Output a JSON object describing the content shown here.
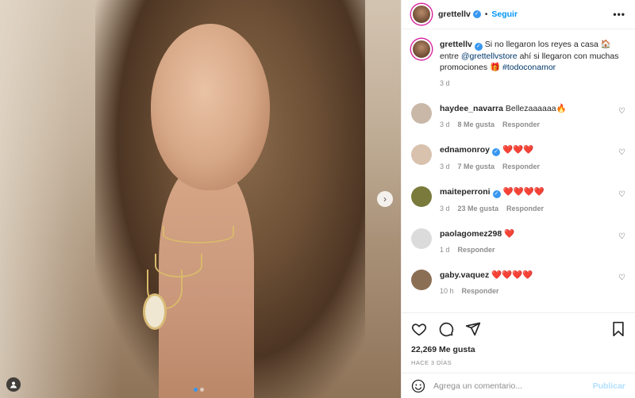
{
  "post": {
    "username": "grettellv",
    "follow_label": "Seguir",
    "more_label": "•••",
    "caption": {
      "username": "grettellv",
      "text_1": "Si no llegaron los reyes a casa 🏠 entre",
      "mention": "@grettellvstore",
      "text_2": "ahí si llegaron con muchas promociones 🎁",
      "hashtag": "#todoconamor",
      "time": "3 d"
    }
  },
  "comments": [
    {
      "username": "haydee_navarra",
      "verified": false,
      "text": "Bellezaaaaaa🔥",
      "time": "3 d",
      "likes": "8 Me gusta",
      "reply": "Responder",
      "avatar_color": "#c9b8a8"
    },
    {
      "username": "ednamonroy",
      "verified": true,
      "text": "❤️❤️❤️",
      "time": "3 d",
      "likes": "7 Me gusta",
      "reply": "Responder",
      "avatar_color": "#d8c2ad"
    },
    {
      "username": "maiteperroni",
      "verified": true,
      "text": "❤️❤️❤️❤️",
      "time": "3 d",
      "likes": "23 Me gusta",
      "reply": "Responder",
      "avatar_color": "#7a7a3c"
    },
    {
      "username": "paolagomez298",
      "verified": false,
      "text": "❤️",
      "time": "1 d",
      "likes": "",
      "reply": "Responder",
      "avatar_color": "#dbdbdb"
    },
    {
      "username": "gaby.vaquez",
      "verified": false,
      "text": "❤️❤️❤️❤️",
      "time": "10 h",
      "likes": "",
      "reply": "Responder",
      "avatar_color": "#8b6f55"
    }
  ],
  "actions": {
    "likes": "22,269 Me gusta",
    "ago": "HACE 3 DÍAS"
  },
  "add_comment": {
    "placeholder": "Agrega un comentario...",
    "publish_label": "Publicar"
  },
  "media": {
    "next_glyph": "›"
  },
  "colors": {
    "accent": "#0095f6",
    "verified": "#3897f0"
  }
}
